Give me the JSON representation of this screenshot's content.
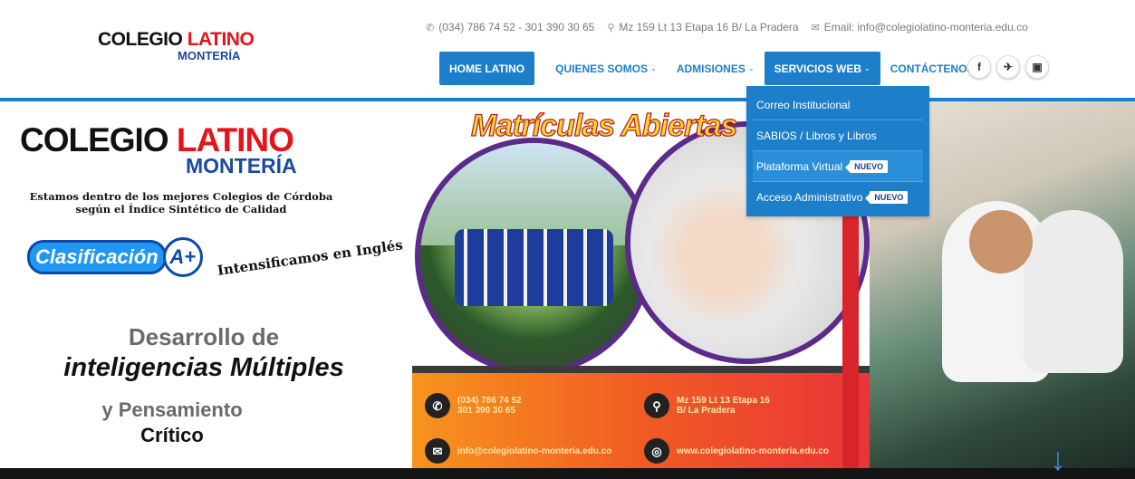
{
  "logo": {
    "line1_black": "COLEGIO",
    "line1_red": "LATINO",
    "line2": "MONTERÍA"
  },
  "topinfo": {
    "phone": "(034) 786 74 52 - 301 390 30 65",
    "address": "Mz 159 Lt 13 Etapa 16 B/ La Pradera",
    "email": "Email: info@colegiolatino-monteria.edu.co"
  },
  "nav": {
    "home": "HOME LATINO",
    "about": "QUIENES SOMOS",
    "admissions": "ADMISIONES",
    "services": "SERVICIOS WEB",
    "contact": "CONTÁCTENOS"
  },
  "social": {
    "facebook": "f",
    "twitter": "✈",
    "instagram": "▣"
  },
  "dropdown": {
    "items": [
      {
        "label": "Correo Institucional"
      },
      {
        "label": "SABIOS / Libros y Libros"
      },
      {
        "label": "Plataforma Virtual",
        "badge": "NUEVO"
      },
      {
        "label": "Acceso Administrativo",
        "badge": "NUEVO"
      }
    ]
  },
  "banner": {
    "title_black": "COLEGIO",
    "title_red": "LATINO",
    "title_sub": "MONTERÍA",
    "ranking_text": "Estamos dentro de los mejores Colegios de Córdoba según el Índice Sintético de Calidad",
    "clasificacion": "Clasificación",
    "grade": "A+",
    "ingles": "Intensificamos en Inglés",
    "dev_line1": "Desarrollo de",
    "dev_line2": "inteligencias Múltiples",
    "dev_line3": "y Pensamiento",
    "dev_line4": "Crítico",
    "matriculas": "Matrículas Abiertas",
    "phone1": "(034) 786 74 52",
    "phone2": "301 390 30 65",
    "addr1": "Mz 159 Lt 13 Etapa 16",
    "addr2": "B/ La Pradera",
    "email": "info@colegiolatino-monteria.edu.co",
    "web": "www.colegiolatino-monteria.edu.co"
  },
  "colors": {
    "accent": "#1d7fc9",
    "brand_red": "#e3141b",
    "brand_blue": "#1a4aa0"
  }
}
